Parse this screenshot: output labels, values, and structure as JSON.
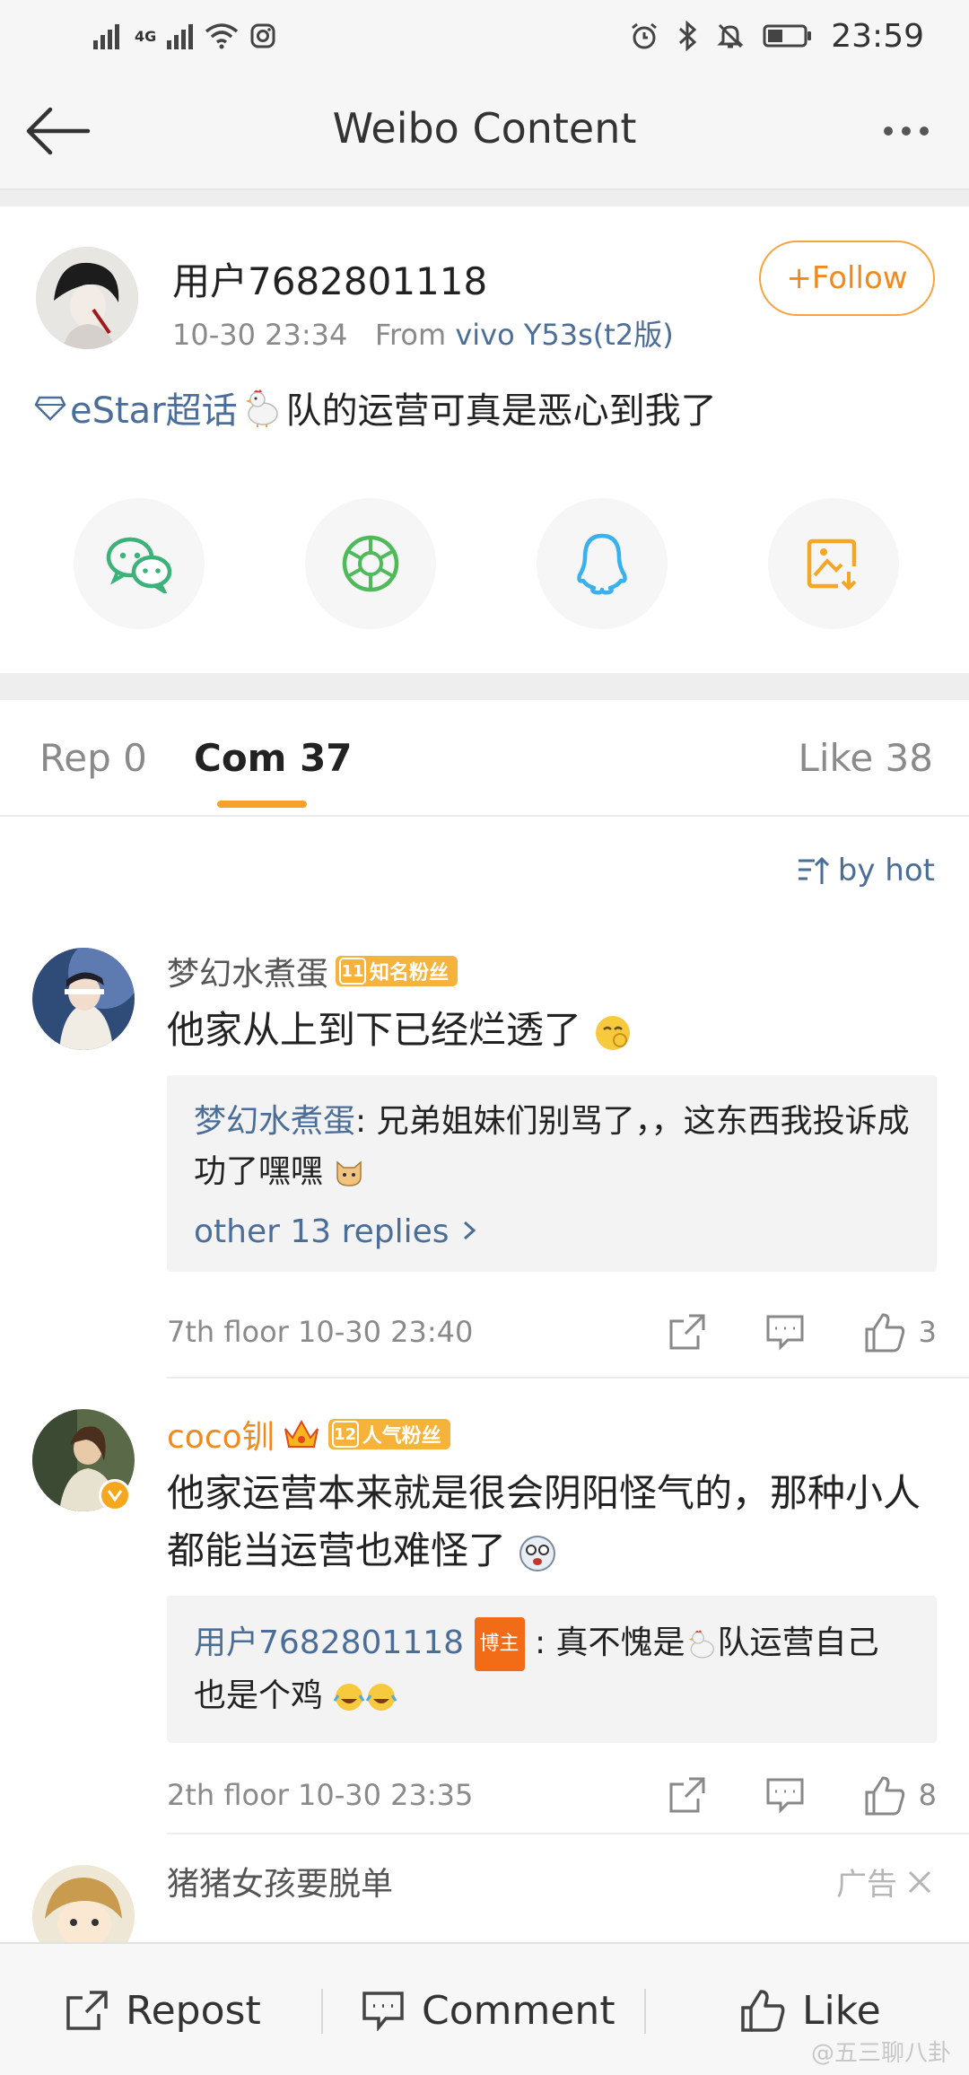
{
  "status_bar": {
    "network": "4G",
    "time": "23:59"
  },
  "nav": {
    "title": "Weibo Content"
  },
  "post": {
    "username": "用户7682801118",
    "timestamp": "10-30 23:34",
    "from_label": "From",
    "device": "vivo Y53s(t2版)",
    "follow_label": "+Follow",
    "topic": "eStar超话",
    "text": "队的运营可真是恶心到我了"
  },
  "share": {
    "items": [
      {
        "icon": "wechat-icon",
        "color": "#3cb27a"
      },
      {
        "icon": "moments-icon",
        "color": "#4fba5a"
      },
      {
        "icon": "qq-icon",
        "color": "#3ab0ec"
      },
      {
        "icon": "save-image-icon",
        "color": "#f5a623"
      }
    ]
  },
  "tabs": [
    {
      "label": "Rep 0"
    },
    {
      "label": "Com 37"
    },
    {
      "label": "Like 38"
    }
  ],
  "sort": {
    "label": "by hot"
  },
  "comments": [
    {
      "name": "梦幻水煮蛋",
      "badge_level": "11",
      "badge_text": "知名粉丝",
      "text": "他家从上到下已经烂透了",
      "reply_name": "梦幻水煮蛋",
      "reply_text": "兄弟姐妹们别骂了，，这东西我投诉成功了嘿嘿",
      "more_replies": "other 13 replies",
      "floor": "7th floor 10-30 23:40",
      "likes": "3"
    },
    {
      "name": "coco钏",
      "badge_level": "12",
      "badge_text": "人气粉丝",
      "text": "他家运营本来就是很会阴阳怪气的，那种小人都能当运营也难怪了",
      "reply_name": "用户7682801118",
      "reply_badge": "博主",
      "reply_text": "真不愧是",
      "reply_text2": "队运营自己也是个鸡",
      "floor": "2th floor 10-30 23:35",
      "likes": "8"
    },
    {
      "name": "猪猪女孩要脱单",
      "ad_label": "广告"
    }
  ],
  "bottom_bar": {
    "repost": "Repost",
    "comment": "Comment",
    "like": "Like"
  },
  "watermark": "@五三聊八卦"
}
